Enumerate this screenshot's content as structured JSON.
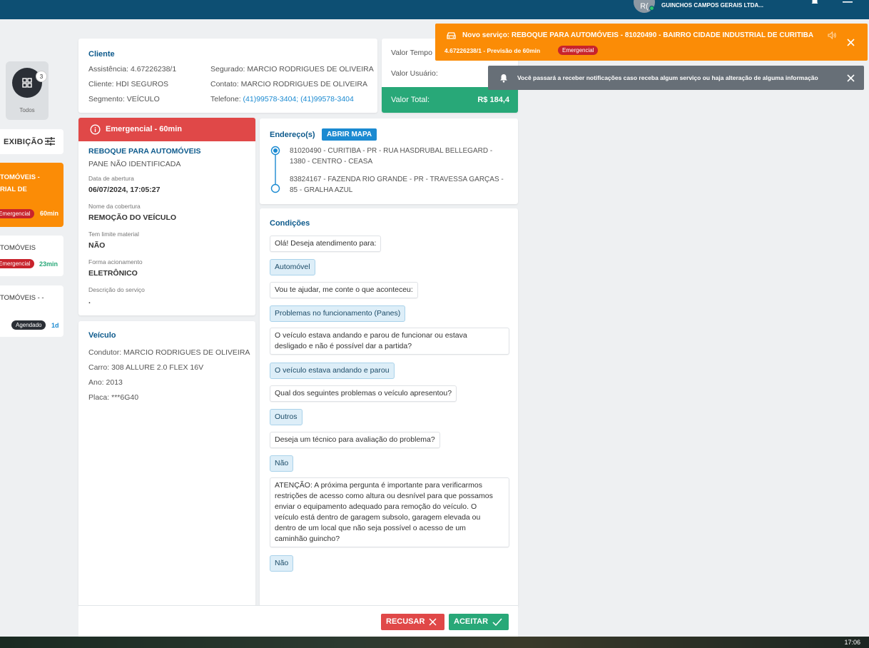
{
  "header": {
    "avatar_initials": "R(",
    "company": "GUINCHOS CAMPOS GERAIS LTDA..."
  },
  "sidebar": {
    "todos_count": "3",
    "todos_label": "Todos",
    "exibicao_label": "EXIBIÇÃO",
    "services": [
      {
        "title_line1": "TOMÓVEIS -",
        "title_line2": "RIAL DE",
        "badge": "Emergencial",
        "time": "60min"
      },
      {
        "title_line1": "TOMÓVEIS",
        "badge": "Emergencial",
        "time": "23min"
      },
      {
        "title_line1": "TOMÓVEIS - -",
        "badge": "Agendado",
        "time": "1d"
      }
    ]
  },
  "cliente": {
    "title": "Cliente",
    "assistencia_label": "Assistência:",
    "assistencia": "4.67226238/1",
    "cliente_label": "Cliente:",
    "cliente": "HDI SEGUROS",
    "segmento_label": "Segmento:",
    "segmento": "VEÍCULO",
    "segurado_label": "Segurado:",
    "segurado": "MARCIO RODRIGUES DE OLIVEIRA",
    "contato_label": "Contato:",
    "contato": "MARCIO RODRIGUES DE OLIVEIRA",
    "telefone_label": "Telefone:",
    "telefone": "(41)99578-3404; (41)99578-3404"
  },
  "valores": {
    "tempo_label": "Valor Tempo",
    "usuario_label": "Valor Usuário:",
    "total_label": "Valor Total:",
    "total_value": "R$ 184,4"
  },
  "servico": {
    "header": "Emergencial - 60min",
    "tipo": "REBOQUE PARA AUTOMÓVEIS",
    "problema": "PANE NÃO IDENTIFICADA",
    "data_label": "Data de abertura",
    "data": "06/07/2024, 17:05:27",
    "cobertura_label": "Nome da cobertura",
    "cobertura": "REMOÇÃO DO VEÍCULO",
    "limite_label": "Tem limite material",
    "limite": "NÃO",
    "forma_label": "Forma acionamento",
    "forma": "ELETRÔNICO",
    "descricao_label": "Descrição do serviço",
    "descricao": "."
  },
  "veiculo": {
    "title": "Veículo",
    "condutor_label": "Condutor:",
    "condutor": "MARCIO RODRIGUES DE OLIVEIRA",
    "carro_label": "Carro:",
    "carro": "308 ALLURE 2.0 FLEX 16V",
    "ano_label": "Ano:",
    "ano": "2013",
    "placa_label": "Placa:",
    "placa": "***6G40"
  },
  "enderecos": {
    "title": "Endereço(s)",
    "map_button": "ABRIR MAPA",
    "origem_l1": "81020490 - CURITIBA - PR - RUA HASDRUBAL BELLEGARD -",
    "origem_l2": "1380 - CENTRO - CEASA",
    "destino_l1": "83824167 - FAZENDA RIO GRANDE - PR - TRAVESSA GARÇAS -",
    "destino_l2": "85 - GRALHA AZUL"
  },
  "condicoes": {
    "title": "Condições",
    "q1": "Olá! Deseja atendimento para:",
    "a1": "Automóvel",
    "q2": "Vou te ajudar, me conte o que aconteceu:",
    "a2": "Problemas no funcionamento (Panes)",
    "q3_l1": "O veículo estava andando e parou de funcionar ou estava",
    "q3_l2": "desligado e não é possível dar a partida?",
    "a3": "O veículo estava andando e parou",
    "q4": "Qual dos seguintes problemas o veículo apresentou?",
    "a4": "Outros",
    "q5": "Deseja um técnico para avaliação do problema?",
    "a5": "Não",
    "q6_l1": "ATENÇÃO: A próxima pergunta é importante para verificarmos",
    "q6_l2": "restrições de acesso como altura ou desnível para que possamos",
    "q6_l3": "enviar o equipamento adequado para remoção do veículo. O",
    "q6_l4": "veículo está dentro de garagem subsolo, garagem elevada ou",
    "q6_l5": "dentro de um local que não seja possível o acesso de um",
    "q6_l6": "caminhão guincho?",
    "a6": "Não"
  },
  "actions": {
    "recusar": "RECUSAR",
    "aceitar": "ACEITAR"
  },
  "toast_new": {
    "title": "Novo serviço: REBOQUE PARA AUTOMÓVEIS - 81020490 - BAIRRO CIDADE INDUSTRIAL DE CURITIBA",
    "subtitle": "4.67226238/1 - Previsão de 60min",
    "badge": "Emergencial"
  },
  "toast_info": {
    "message": "Você passará a receber notificações caso receba algum serviço ou haja alteração de alguma informação"
  },
  "taskbar": {
    "clock": "17:06"
  },
  "colors": {
    "header_bg": "#0d4f73",
    "emergency_red": "#e04848",
    "accent_orange": "#fb8c06",
    "success_green": "#28a878",
    "link_blue": "#1b8ad1"
  }
}
